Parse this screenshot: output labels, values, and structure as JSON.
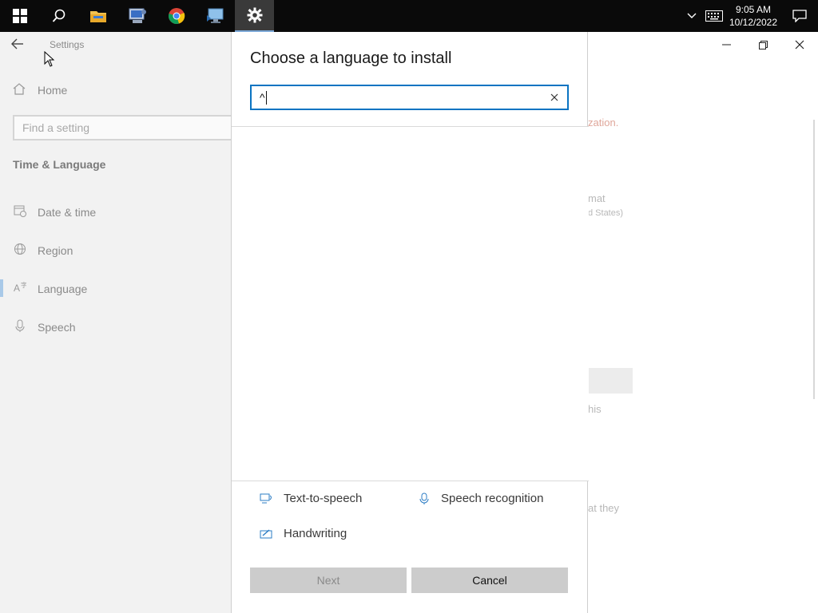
{
  "taskbar": {
    "apps": [
      "start-icon",
      "search-icon",
      "file-explorer-icon",
      "network-utility-icon",
      "chrome-icon",
      "remote-desktop-icon",
      "settings-icon"
    ],
    "clock": {
      "time": "9:05 AM",
      "date": "10/12/2022"
    }
  },
  "settings_window": {
    "title": "Settings",
    "home_label": "Home",
    "find_placeholder": "Find a setting",
    "section_title": "Time & Language",
    "nav_items": [
      {
        "label": "Date & time",
        "icon": "calendar-clock-icon"
      },
      {
        "label": "Region",
        "icon": "globe-icon"
      },
      {
        "label": "Language",
        "icon": "language-icon",
        "selected": true
      },
      {
        "label": "Speech",
        "icon": "microphone-icon"
      }
    ],
    "background_fragments": {
      "error_fragment": "zation.",
      "format_fragment": "mat",
      "country_fragment": "d States)",
      "this_fragment": "his",
      "they_fragment": "at they"
    }
  },
  "dialog": {
    "title": "Choose a language to install",
    "search_value": "^",
    "features": {
      "tts": "Text-to-speech",
      "speech": "Speech recognition",
      "handwriting": "Handwriting"
    },
    "next_label": "Next",
    "cancel_label": "Cancel"
  },
  "colors": {
    "accent": "#0a74c2",
    "taskbar": "#0a0a0a",
    "button": "#cccccc"
  }
}
